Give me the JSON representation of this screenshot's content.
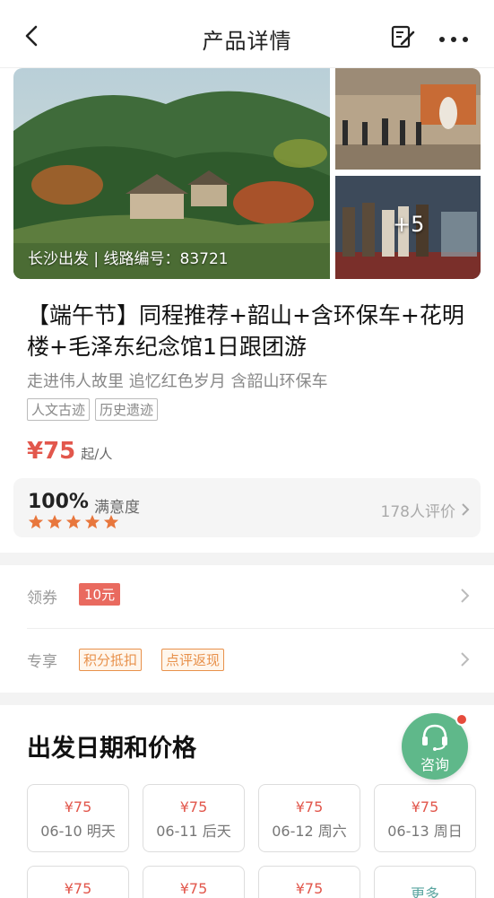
{
  "header": {
    "title": "产品详情"
  },
  "gallery": {
    "caption": "长沙出发 | 线路编号：83721",
    "more_count": "+5"
  },
  "product": {
    "title": "【端午节】同程推荐+韶山+含环保车+花明楼+毛泽东纪念馆1日跟团游",
    "subtitle": "走进伟人故里 追忆红色岁月 含韶山环保车",
    "tags": [
      "人文古迹",
      "历史遗迹"
    ],
    "price": "¥75",
    "price_unit": "起/人"
  },
  "rating": {
    "percent": "100%",
    "label": "满意度",
    "stars": 5,
    "reviews": "178人评价"
  },
  "coupon_row": {
    "label": "领券",
    "coupon": "10元"
  },
  "perks_row": {
    "label": "专享",
    "perks": [
      "积分抵扣",
      "点评返现"
    ]
  },
  "dates": {
    "title": "出发日期和价格",
    "items": [
      {
        "price": "¥75",
        "day": "06-10 明天"
      },
      {
        "price": "¥75",
        "day": "06-11 后天"
      },
      {
        "price": "¥75",
        "day": "06-12 周六"
      },
      {
        "price": "¥75",
        "day": "06-13 周日"
      },
      {
        "price": "¥75",
        "day": ""
      },
      {
        "price": "¥75",
        "day": ""
      },
      {
        "price": "¥75",
        "day": ""
      }
    ],
    "more": "更多"
  },
  "consult": {
    "label": "咨询"
  },
  "colors": {
    "price_red": "#e2574c",
    "consult_green": "#5fb88a",
    "perk_orange": "#e8914b",
    "link_teal": "#5aa5a0"
  }
}
